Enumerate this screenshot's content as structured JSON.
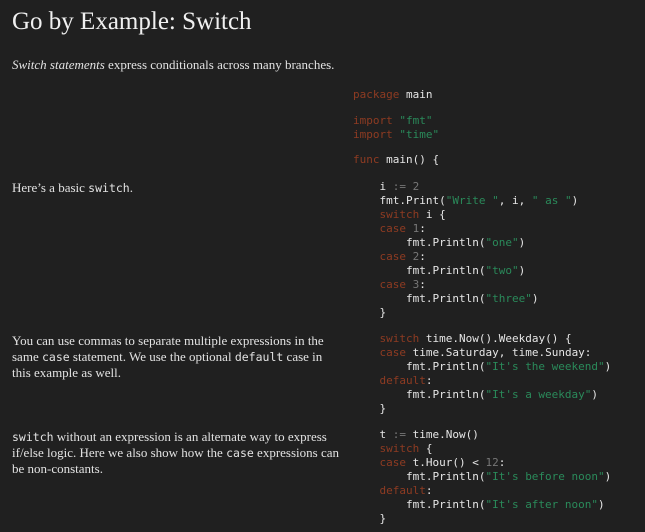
{
  "title": "Go by Example: Switch",
  "intro": {
    "em": "Switch statements",
    "rest": " express conditionals across many branches."
  },
  "sections": [
    {
      "doc": [
        "Here’s a basic ",
        {
          "code": "switch"
        },
        "."
      ]
    },
    {
      "doc": [
        "You can use commas to separate multiple expressions in the same ",
        {
          "code": "case"
        },
        " statement. We use the optional ",
        {
          "code": "default"
        },
        " case in this example as well."
      ]
    },
    {
      "doc": [
        {
          "code": "switch"
        },
        " without an expression is an alternate way to express if/else logic. Here we also show how the ",
        {
          "code": "case"
        },
        " expressions can be non-constants."
      ]
    }
  ],
  "code_blocks": [
    [
      [
        [
          "kw",
          "package"
        ],
        [
          "t",
          " main"
        ]
      ]
    ],
    [
      [
        [
          "kw",
          "import"
        ],
        [
          "t",
          " "
        ],
        [
          "str",
          "\"fmt\""
        ]
      ],
      [
        [
          "kw",
          "import"
        ],
        [
          "t",
          " "
        ],
        [
          "str",
          "\"time\""
        ]
      ]
    ],
    [
      [
        [
          "kw",
          "func"
        ],
        [
          "t",
          " main() {"
        ]
      ]
    ],
    [
      [
        [
          "t",
          "    i "
        ],
        [
          "op",
          ":="
        ],
        [
          "t",
          " "
        ],
        [
          "num",
          "2"
        ]
      ],
      [
        [
          "t",
          "    fmt.Print("
        ],
        [
          "str",
          "\"Write \""
        ],
        [
          "t",
          ", i, "
        ],
        [
          "str",
          "\" as \""
        ],
        [
          "t",
          ")"
        ]
      ],
      [
        [
          "t",
          "    "
        ],
        [
          "kw",
          "switch"
        ],
        [
          "t",
          " i {"
        ]
      ],
      [
        [
          "t",
          "    "
        ],
        [
          "kw",
          "case"
        ],
        [
          "t",
          " "
        ],
        [
          "num",
          "1"
        ],
        [
          "t",
          ":"
        ]
      ],
      [
        [
          "t",
          "        fmt.Println("
        ],
        [
          "str",
          "\"one\""
        ],
        [
          "t",
          ")"
        ]
      ],
      [
        [
          "t",
          "    "
        ],
        [
          "kw",
          "case"
        ],
        [
          "t",
          " "
        ],
        [
          "num",
          "2"
        ],
        [
          "t",
          ":"
        ]
      ],
      [
        [
          "t",
          "        fmt.Println("
        ],
        [
          "str",
          "\"two\""
        ],
        [
          "t",
          ")"
        ]
      ],
      [
        [
          "t",
          "    "
        ],
        [
          "kw",
          "case"
        ],
        [
          "t",
          " "
        ],
        [
          "num",
          "3"
        ],
        [
          "t",
          ":"
        ]
      ],
      [
        [
          "t",
          "        fmt.Println("
        ],
        [
          "str",
          "\"three\""
        ],
        [
          "t",
          ")"
        ]
      ],
      [
        [
          "t",
          "    }"
        ]
      ]
    ],
    [
      [
        [
          "t",
          "    "
        ],
        [
          "kw",
          "switch"
        ],
        [
          "t",
          " time.Now().Weekday() {"
        ]
      ],
      [
        [
          "t",
          "    "
        ],
        [
          "kw",
          "case"
        ],
        [
          "t",
          " time.Saturday, time.Sunday:"
        ]
      ],
      [
        [
          "t",
          "        fmt.Println("
        ],
        [
          "str",
          "\"It's the weekend\""
        ],
        [
          "t",
          ")"
        ]
      ],
      [
        [
          "t",
          "    "
        ],
        [
          "kw",
          "default"
        ],
        [
          "t",
          ":"
        ]
      ],
      [
        [
          "t",
          "        fmt.Println("
        ],
        [
          "str",
          "\"It's a weekday\""
        ],
        [
          "t",
          ")"
        ]
      ],
      [
        [
          "t",
          "    }"
        ]
      ]
    ],
    [
      [
        [
          "t",
          "    t "
        ],
        [
          "op",
          ":="
        ],
        [
          "t",
          " time.Now()"
        ]
      ],
      [
        [
          "t",
          "    "
        ],
        [
          "kw",
          "switch"
        ],
        [
          "t",
          " {"
        ]
      ],
      [
        [
          "t",
          "    "
        ],
        [
          "kw",
          "case"
        ],
        [
          "t",
          " t.Hour() < "
        ],
        [
          "num",
          "12"
        ],
        [
          "t",
          ":"
        ]
      ],
      [
        [
          "t",
          "        fmt.Println("
        ],
        [
          "str",
          "\"It's before noon\""
        ],
        [
          "t",
          ")"
        ]
      ],
      [
        [
          "t",
          "    "
        ],
        [
          "kw",
          "default"
        ],
        [
          "t",
          ":"
        ]
      ],
      [
        [
          "t",
          "        fmt.Println("
        ],
        [
          "str",
          "\"It's after noon\""
        ],
        [
          "t",
          ")"
        ]
      ],
      [
        [
          "t",
          "    }"
        ]
      ]
    ]
  ]
}
